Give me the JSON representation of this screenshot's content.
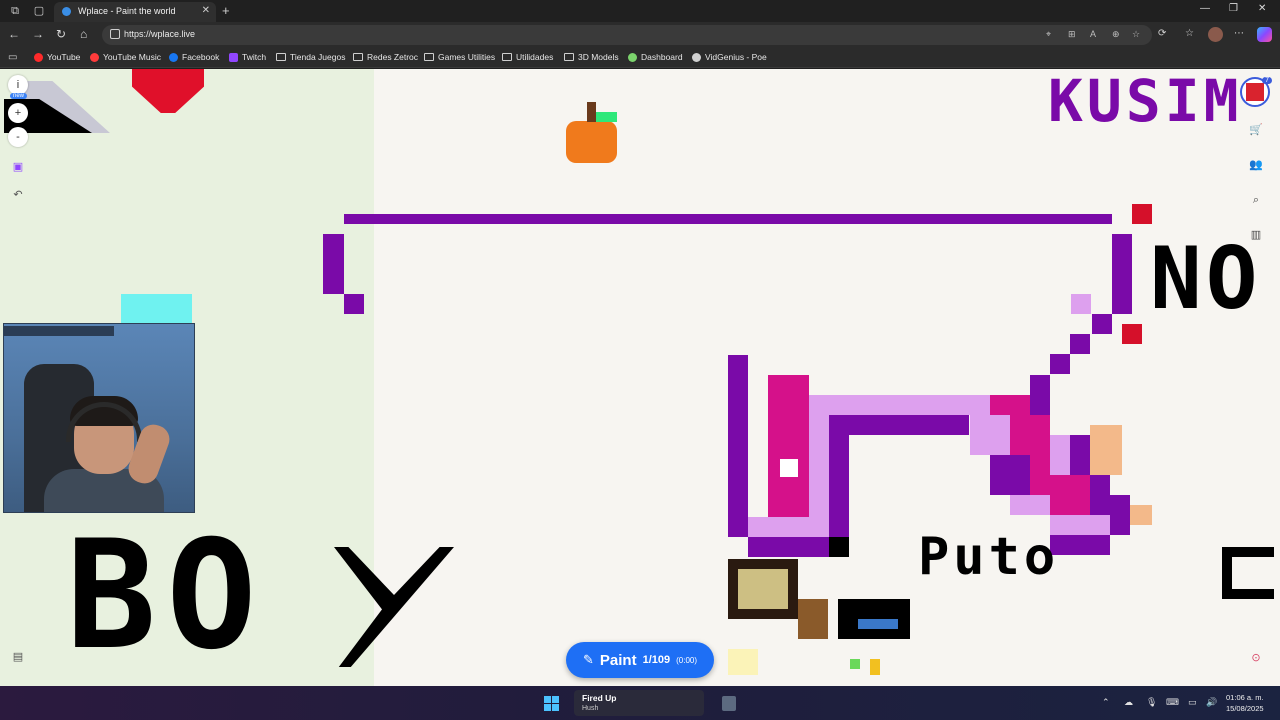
{
  "browser": {
    "tab_title": "Wplace - Paint the world",
    "url": "https://wplace.live",
    "bookmarks": [
      "YouTube",
      "YouTube Music",
      "Facebook",
      "Twitch",
      "Tienda Juegos",
      "Redes Zetroc",
      "Games Utilities",
      "Utilidades",
      "3D Models",
      "Dashboard",
      "VidGenius - Poe"
    ],
    "colors": {
      "tab_bg": "#2f2f2f",
      "toolbar_bg": "#2b2b2b",
      "frame_bg": "#202020"
    }
  },
  "canvas": {
    "left_tools": {
      "info": "i",
      "new_badge": "new",
      "zoom_in": "+",
      "zoom_out": "-"
    },
    "paint_button": {
      "label": "Paint",
      "count": "1/109",
      "timer": "(0:00)"
    },
    "profile_level": "7",
    "pixel_text": {
      "top_right": "KUSIM",
      "right": "NO",
      "middle": "Puto",
      "bottom_left": "BO"
    },
    "colors": {
      "purple": "#7a0aa8",
      "magenta": "#d5118a",
      "lilac": "#dda0ee",
      "accent_blue": "#1e6ff5"
    }
  },
  "taskbar": {
    "media_title": "Fired Up",
    "media_artist": "Hush",
    "time": "01:06 a. m.",
    "date": "15/08/2025"
  }
}
